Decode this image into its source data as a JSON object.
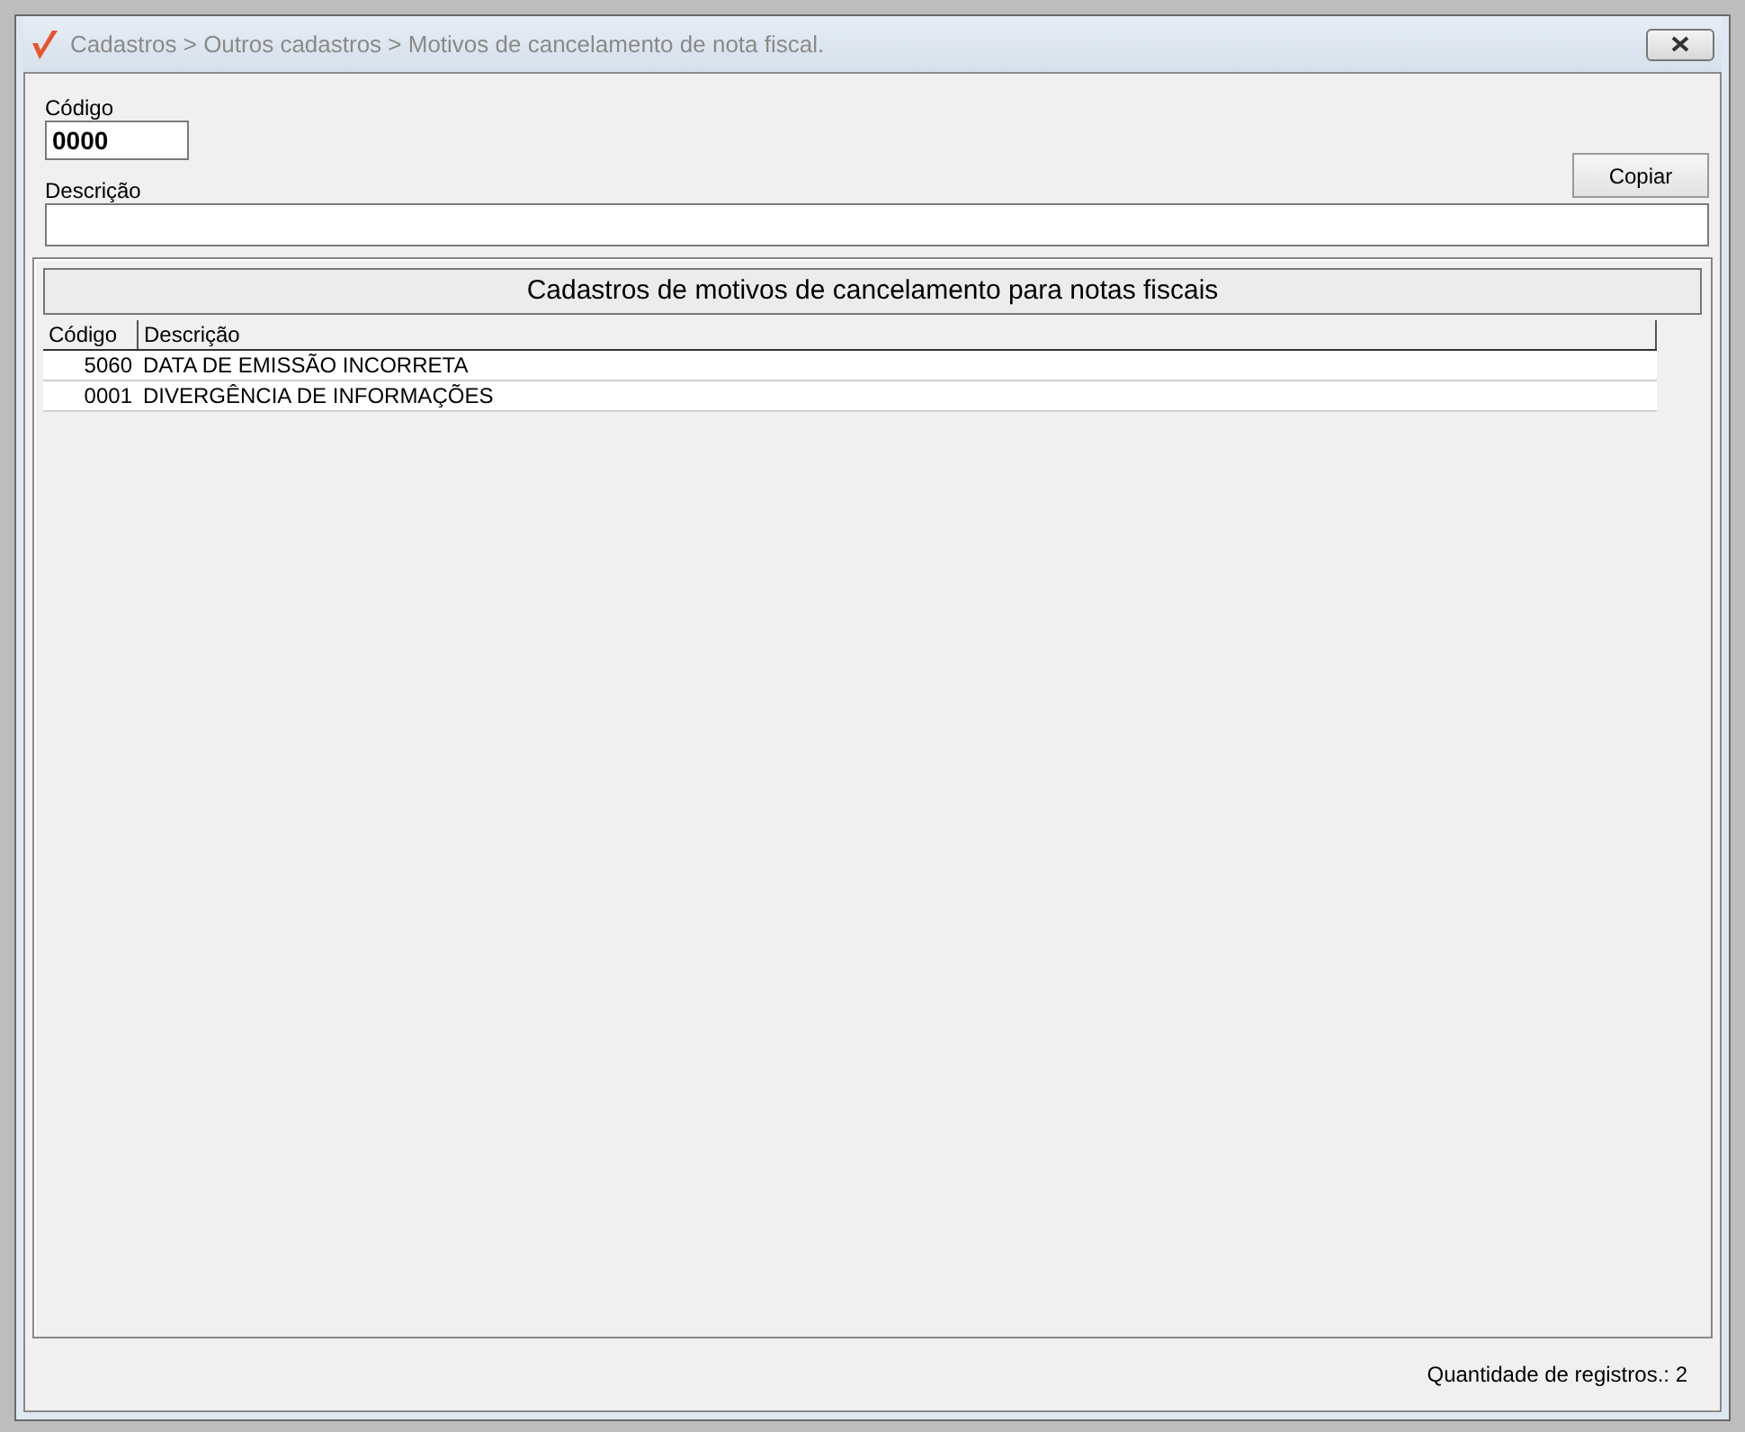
{
  "window": {
    "title": "Cadastros > Outros cadastros > Motivos de cancelamento de nota fiscal."
  },
  "form": {
    "code_label": "Código",
    "code_value": "0000",
    "description_label": "Descrição",
    "copy_button": "Copiar"
  },
  "panel": {
    "title": "Cadastros de motivos de cancelamento para notas fiscais"
  },
  "table": {
    "columns": [
      "Código",
      "Descrição"
    ],
    "rows": [
      [
        "5060",
        "DATA DE EMISSÃO INCORRETA"
      ],
      [
        "0001",
        "DIVERGÊNCIA DE INFORMAÇÕES"
      ]
    ]
  },
  "status_bar": "Quantidade de registros.: 2"
}
